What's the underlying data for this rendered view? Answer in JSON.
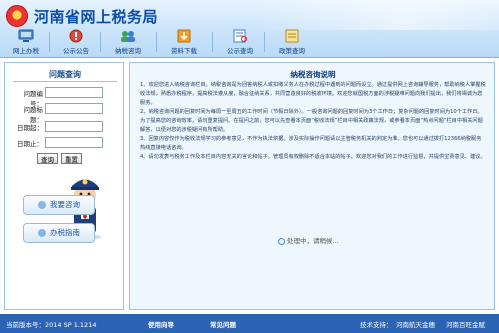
{
  "header": {
    "title": "河南省网上税务局"
  },
  "nav": [
    {
      "label": "网上办税",
      "icon": "computer-icon"
    },
    {
      "label": "公示公告",
      "icon": "notice-icon"
    },
    {
      "label": "纳税咨询",
      "icon": "consult-icon"
    },
    {
      "label": "资料下载",
      "icon": "download-icon"
    },
    {
      "label": "公示查询",
      "icon": "query-icon"
    },
    {
      "label": "政策查询",
      "icon": "policy-icon"
    }
  ],
  "sidebar": {
    "title": "问题查询",
    "fields": {
      "number_label": "问题编号：",
      "title_label": "问题标题：",
      "date_start_label": "日期起：",
      "date_end_label": "日期止：",
      "number_value": "",
      "title_value": "",
      "date_start_value": "",
      "date_end_value": ""
    },
    "query_button": "查询",
    "reset_button": "重置",
    "ask_button": "我要咨询",
    "guide_button": "办税指南"
  },
  "content": {
    "title": "纳税咨询说明",
    "paragraphs": [
      "1、欢迎您进入纳税咨询栏目。纳税咨询是为回答纳税人或扣缴义务人在办税过程中遇到的问题而设立。通过提供网上咨询辅导服务，帮助纳税人掌握税收法规，熟悉办税程序，提高税法遵从度，融合征纳关系，共同营造良好的税收环境。欢迎您就国税方面的涉税疑难问题向我们提出，我们将竭诚为您服务。",
      "2、纳税咨询问题的回复时间为每周一至周五的工作时间（节假日除外）。一般咨询问题的回复时间为3个工作日；复杂问题的回复时间为10个工作日。为了提高您的咨询效率，请勿重复提问。在提问之前，您可以先查看本页面“税收法规”栏目中相关政策法规，或参看本页面“热点问题”栏目中相关问题解答，以便对您的涉税疑问有所帮助。",
      "3、回复内容仅作为税收法规学习的参考意见，不作为执法依据。涉及实际操作问题请以主管税务机关的判定为准。您也可以通过拨打12366纳税服务热线直接电话咨询。",
      "4、请勿发表与税务工作及本栏目内容无关的言论和帖子。管理员有权删除不适合本站的帖子。欢迎您对我们的工作进行监督，并提供宝贵意见、建议。"
    ],
    "status": "处理中，请稍候..."
  },
  "footer": {
    "version": "当前版本号：2014 SP 1.1214",
    "help": "使用向导",
    "faq": "常见问题",
    "support_label": "技术支持：",
    "support1": "河南航天金穗",
    "support2": "河南百旺金赋"
  }
}
